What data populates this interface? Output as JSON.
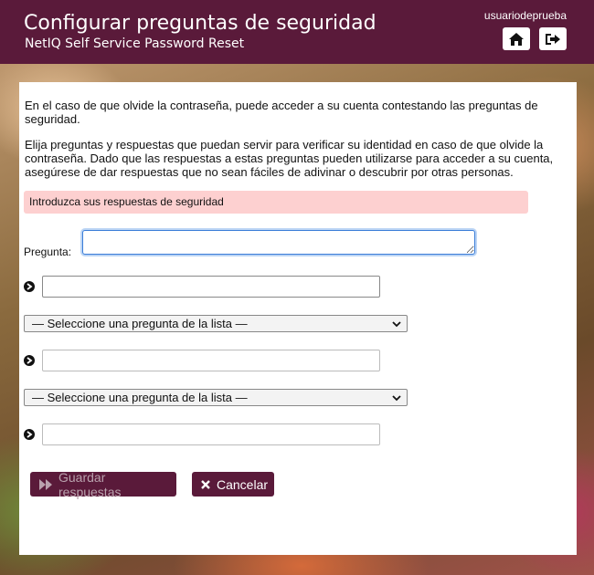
{
  "header": {
    "title": "Configurar preguntas de seguridad",
    "subtitle": "NetIQ Self Service Password Reset",
    "username": "usuariodeprueba"
  },
  "intro": {
    "paragraph1": "En el caso de que olvide la contraseña, puede acceder a su cuenta contestando las preguntas de seguridad.",
    "paragraph2": "Elija preguntas y respuestas que puedan servir para verificar su identidad en caso de que olvide la contraseña. Dado que las respuestas a estas preguntas pueden utilizarse para acceder a su cuenta, asegúrese de dar respuestas que no sean fáciles de adivinar o descubrir por otras personas."
  },
  "alert": {
    "text": "Introduzca sus respuestas de seguridad"
  },
  "form": {
    "question_label": "Pregunta:",
    "question_value": "",
    "answer1_value": "",
    "select2_value": "— Seleccione una pregunta de la lista —",
    "answer2_value": "",
    "select3_value": "— Seleccione una pregunta de la lista —",
    "answer3_value": ""
  },
  "buttons": {
    "save_label": "Guardar respuestas",
    "cancel_label": "Cancelar"
  },
  "icons": {
    "home": "home-icon",
    "logout": "logout-icon",
    "bullet": "circle-arrow-icon",
    "save": "fast-forward-icon",
    "cancel": "close-icon"
  },
  "colors": {
    "brand": "#5a1a3a",
    "alert_bg": "#fdd0d0",
    "focus": "#3b7dd8"
  }
}
